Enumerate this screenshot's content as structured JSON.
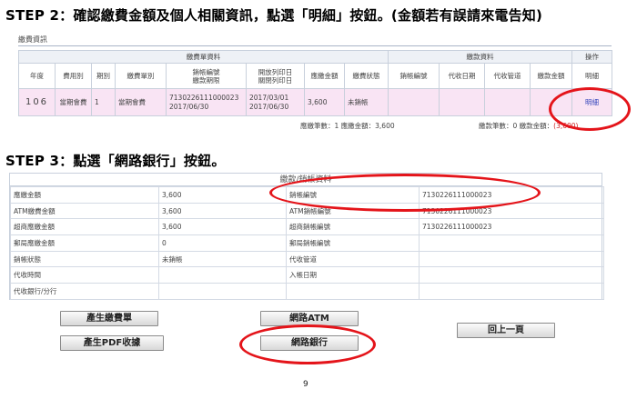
{
  "step2": "STEP 2：確認繳費金額及個人相關資訊，點選「明細」按鈕。(金額若有誤請來電告知)",
  "step3": "STEP 3：點選「網路銀行」按鈕。",
  "section1": {
    "title": "繳費資訊",
    "group_headers": [
      "繳費單資料",
      "繳款資料",
      "操作"
    ],
    "columns": [
      "年度",
      "費用別",
      "期別",
      "繳費單別",
      "銷帳編號\n繳款期限",
      "開放列印日\n關閉列印日",
      "應繳金額",
      "繳費狀態",
      "銷帳編號",
      "代收日期",
      "代收管道",
      "繳款金額",
      "明細"
    ],
    "row": {
      "year": "106",
      "fee_type": "當期會費",
      "period": "1",
      "bill_type": "當期會費",
      "account_no": "7130226111000023",
      "due_date": "2017/06/30",
      "print_open": "2017/03/01",
      "print_close": "2017/06/30",
      "amount": "3,600",
      "status": "未銷帳",
      "pay_account": "",
      "collect_date": "",
      "collect_channel": "",
      "pay_amount": "",
      "action": "明細"
    },
    "summary1": "應繳筆數：1  應繳金額：3,600",
    "summary2_prefix": "繳款筆數：0  繳款金額：",
    "summary2_value": "(3,600)"
  },
  "section2": {
    "header": "繳款/銷帳資料",
    "rows": [
      [
        "應繳金額",
        "3,600",
        "銷帳編號",
        "7130226111000023"
      ],
      [
        "ATM繳費金額",
        "3,600",
        "ATM銷帳編號",
        "7130226111000023"
      ],
      [
        "超商應繳金額",
        "3,600",
        "超商銷帳編號",
        "7130226111000023"
      ],
      [
        "郵局應繳金額",
        "0",
        "郵局銷帳編號",
        ""
      ],
      [
        "銷帳狀態",
        "未銷帳",
        "代收管道",
        ""
      ],
      [
        "代收時間",
        "",
        "入帳日期",
        ""
      ],
      [
        "代收銀行/分行",
        "",
        "",
        ""
      ]
    ]
  },
  "buttons": {
    "invoice": "產生繳費單",
    "pdf": "產生PDF收據",
    "atm": "網路ATM",
    "bank": "網路銀行",
    "back": "回上一頁"
  },
  "page_number": "9",
  "colors": {
    "annotation": "#e4141a",
    "row_highlight": "#f9e4f4",
    "link": "#3344bb"
  }
}
